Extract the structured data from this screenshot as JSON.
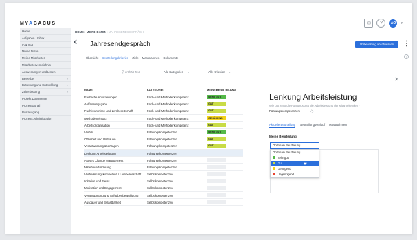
{
  "brand": {
    "logo_prefix": "MY",
    "logo_accent": "A",
    "logo_rest": "BACUS",
    "accent_color": "#2b6fdb"
  },
  "header_icons": [
    "mail-icon",
    "help-icon"
  ],
  "user": {
    "initials": "AO"
  },
  "sidebar": {
    "items": [
      {
        "label": "Home",
        "chevron": false
      },
      {
        "label": "Aufgaben | Inbox",
        "chevron": false
      },
      {
        "label": "In & Out",
        "chevron": false
      },
      {
        "label": "Meine Daten",
        "chevron": false
      },
      {
        "label": "Meine Mitarbeiter",
        "chevron": false
      },
      {
        "label": "Mitarbeiterverzeichnis",
        "chevron": false
      },
      {
        "label": "Auswertungen und Listen",
        "chevron": false
      },
      {
        "label": "Bewerber",
        "chevron": true
      },
      {
        "label": "Betreuung und Entwicklung",
        "chevron": true
      },
      {
        "label": "Zeiterfassung",
        "chevron": true
      },
      {
        "label": "Projekt Dokumente",
        "chevron": false
      },
      {
        "label": "Prozessportal",
        "chevron": false
      },
      {
        "label": "Postausgang",
        "chevron": false
      },
      {
        "label": "Prozess Administration",
        "chevron": false
      }
    ]
  },
  "breadcrumb": {
    "home": "HOME",
    "sep": "›",
    "level1": "MEINE DATEN",
    "current": "JAHRESENDGESPRÄCH"
  },
  "page": {
    "title": "Jahresendgespräch",
    "primary_action": "Vorbereitung abschliessen"
  },
  "tabs": [
    {
      "label": "Übersicht",
      "active": false
    },
    {
      "label": "Beurteilungskriterien",
      "active": true
    },
    {
      "label": "Ziele",
      "active": false
    },
    {
      "label": "Massnahmen",
      "active": false
    },
    {
      "label": "Dokumente",
      "active": false
    }
  ],
  "filters": {
    "search_placeholder": "enthält Text",
    "category": "Alle Kategorien",
    "criteria": "Alle Kriterien"
  },
  "table": {
    "columns": [
      "NAME",
      "KATEGORIE",
      "MEINE BEURTEILUNG"
    ],
    "rows": [
      {
        "name": "Fachliche Anforderungen",
        "category": "Fach- und Methodenkompetenz",
        "rating": "SEHR GUT",
        "color": "#54b948",
        "selected": false
      },
      {
        "name": "Auffassungsgabe",
        "category": "Fach- und Methodenkompetenz",
        "rating": "GUT",
        "color": "#c9dc46",
        "selected": false
      },
      {
        "name": "Fachkenntnisse und Lernbereitschaft",
        "category": "Fach- und Methodenkompetenz",
        "rating": "GUT",
        "color": "#c9dc46",
        "selected": false
      },
      {
        "name": "Methodeneinsatz",
        "category": "Fach- und Methodenkompetenz",
        "rating": "GENÜGEND",
        "color": "#f3d21a",
        "selected": false
      },
      {
        "name": "Arbeitsorganisation",
        "category": "Fach- und Methodenkompetenz",
        "rating": "GUT",
        "color": "#c9dc46",
        "selected": false
      },
      {
        "name": "Vorbild",
        "category": "Führungskompetenzen",
        "rating": "SEHR GUT",
        "color": "#54b948",
        "selected": false
      },
      {
        "name": "Offenheit und Vertrauen",
        "category": "Führungskompetenzen",
        "rating": "GUT",
        "color": "#c9dc46",
        "selected": false
      },
      {
        "name": "Verantwortung übertragen",
        "category": "Führungskompetenzen",
        "rating": "GUT",
        "color": "#c9dc46",
        "selected": false
      },
      {
        "name": "Lenkung Arbeitsleistung",
        "category": "Führungskompetenzen",
        "rating": "",
        "color": "",
        "selected": true
      },
      {
        "name": "Aktives Change Management",
        "category": "Führungskompetenzen",
        "rating": "",
        "color": "#eceef1",
        "selected": false
      },
      {
        "name": "Mitarbeiterförderung",
        "category": "Führungskompetenzen",
        "rating": "",
        "color": "#eceef1",
        "selected": false
      },
      {
        "name": "Veränderungskompetenz / Lernbereitschaft",
        "category": "Selbstkompetenzen",
        "rating": "",
        "color": "#eceef1",
        "selected": false
      },
      {
        "name": "Initiative und Fleiss",
        "category": "Selbstkompetenzen",
        "rating": "",
        "color": "#eceef1",
        "selected": false
      },
      {
        "name": "Motivation und Engagement",
        "category": "Selbstkompetenzen",
        "rating": "",
        "color": "#eceef1",
        "selected": false
      },
      {
        "name": "Verantwortung und Aufgabenbewältigung",
        "category": "Selbstkompetenzen",
        "rating": "",
        "color": "#eceef1",
        "selected": false
      },
      {
        "name": "Ausdauer und Belastbarkeit",
        "category": "Selbstkompetenzen",
        "rating": "",
        "color": "#eceef1",
        "selected": false
      }
    ]
  },
  "detail": {
    "title": "Lenkung Arbeitsleistung",
    "question": "Wie gut lenkt die Führungskraft die Arbeitsleistung der Mitarbeitenden?",
    "category_chip": "Führungskompetenzen",
    "tabs": [
      {
        "label": "Aktuelle Beurteilung",
        "active": true
      },
      {
        "label": "Beurteilungsverlauf",
        "active": false
      },
      {
        "label": "Massnahmen",
        "active": false
      }
    ],
    "field_label": "Meine Beurteilung",
    "select_value": "Optionale Beurteilung...",
    "options": [
      {
        "label": "Optionale Beurteilung...",
        "color": "",
        "highlighted": false
      },
      {
        "label": "Sehr gut",
        "color": "#54b948",
        "highlighted": false
      },
      {
        "label": "Gut",
        "color": "#c9dc46",
        "highlighted": true
      },
      {
        "label": "Genügend",
        "color": "#f3d21a",
        "highlighted": false
      },
      {
        "label": "Ungenügend",
        "color": "#e8402d",
        "highlighted": false
      }
    ]
  }
}
